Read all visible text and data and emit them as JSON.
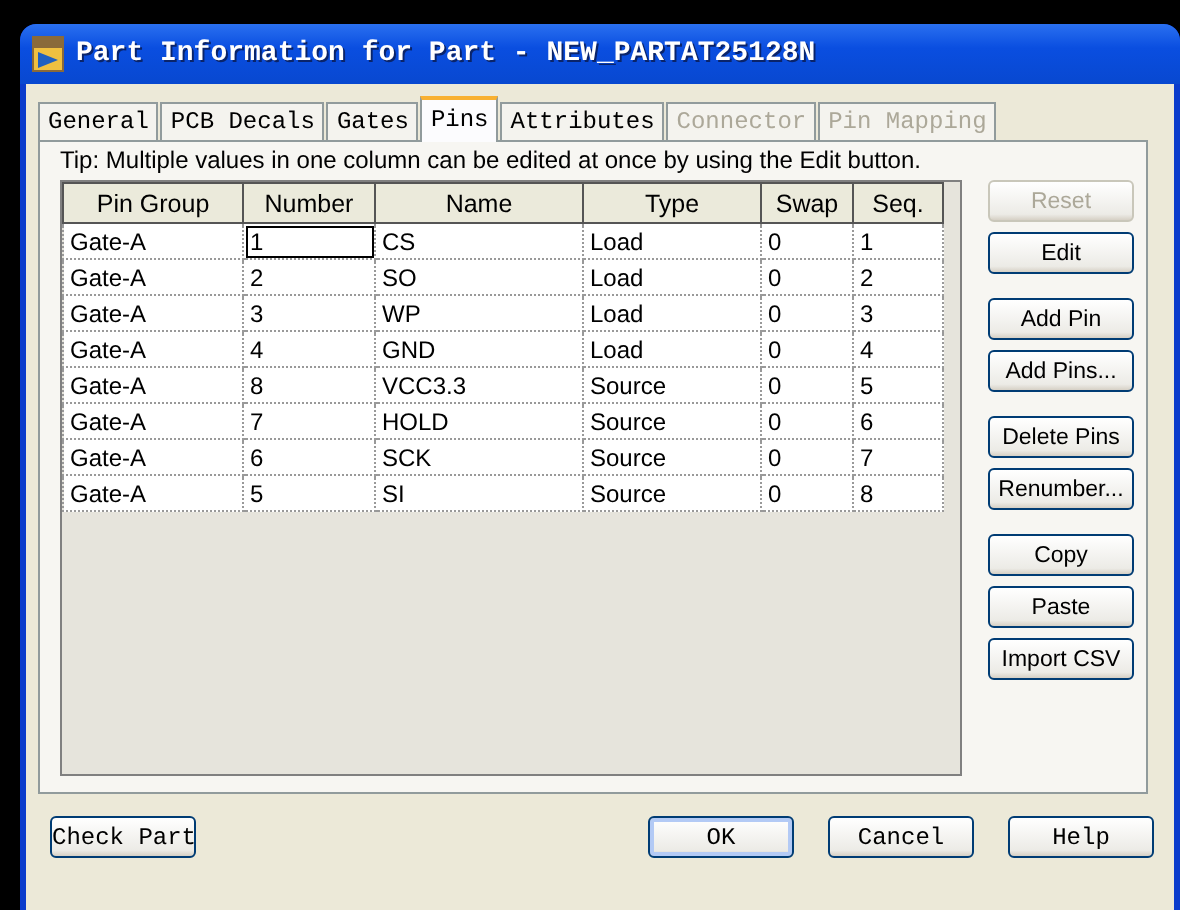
{
  "window": {
    "title": "Part Information for Part - NEW_PARTAT25128N"
  },
  "tabs": [
    {
      "label": "General",
      "selected": false,
      "disabled": false
    },
    {
      "label": "PCB Decals",
      "selected": false,
      "disabled": false
    },
    {
      "label": "Gates",
      "selected": false,
      "disabled": false
    },
    {
      "label": "Pins",
      "selected": true,
      "disabled": false
    },
    {
      "label": "Attributes",
      "selected": false,
      "disabled": false
    },
    {
      "label": "Connector",
      "selected": false,
      "disabled": true
    },
    {
      "label": "Pin Mapping",
      "selected": false,
      "disabled": true
    }
  ],
  "tip": "Tip: Multiple values in one column can be edited at once by using the Edit button.",
  "table": {
    "columns": [
      "Pin Group",
      "Number",
      "Name",
      "Type",
      "Swap",
      "Seq."
    ],
    "rows": [
      {
        "cells": [
          "Gate-A",
          "1",
          "CS",
          "Load",
          "0",
          "1"
        ],
        "focused": true
      },
      {
        "cells": [
          "Gate-A",
          "2",
          "SO",
          "Load",
          "0",
          "2"
        ],
        "focused": false
      },
      {
        "cells": [
          "Gate-A",
          "3",
          "WP",
          "Load",
          "0",
          "3"
        ],
        "focused": false
      },
      {
        "cells": [
          "Gate-A",
          "4",
          "GND",
          "Load",
          "0",
          "4"
        ],
        "focused": false
      },
      {
        "cells": [
          "Gate-A",
          "8",
          "VCC3.3",
          "Source",
          "0",
          "5"
        ],
        "focused": false
      },
      {
        "cells": [
          "Gate-A",
          "7",
          "HOLD",
          "Source",
          "0",
          "6"
        ],
        "focused": false
      },
      {
        "cells": [
          "Gate-A",
          "6",
          "SCK",
          "Source",
          "0",
          "7"
        ],
        "focused": false
      },
      {
        "cells": [
          "Gate-A",
          "5",
          "SI",
          "Source",
          "0",
          "8"
        ],
        "focused": false
      }
    ]
  },
  "side_button_groups": [
    [
      {
        "label": "Reset",
        "disabled": true
      },
      {
        "label": "Edit",
        "disabled": false
      }
    ],
    [
      {
        "label": "Add Pin",
        "disabled": false
      },
      {
        "label": "Add Pins...",
        "disabled": false
      }
    ],
    [
      {
        "label": "Delete Pins",
        "disabled": false
      },
      {
        "label": "Renumber...",
        "disabled": false
      }
    ],
    [
      {
        "label": "Copy",
        "disabled": false
      },
      {
        "label": "Paste",
        "disabled": false
      },
      {
        "label": "Import CSV",
        "disabled": false
      }
    ]
  ],
  "footer": {
    "left": "Check Part",
    "right": [
      {
        "label": "OK",
        "default": true
      },
      {
        "label": "Cancel",
        "default": false
      },
      {
        "label": "Help",
        "default": false
      }
    ]
  }
}
